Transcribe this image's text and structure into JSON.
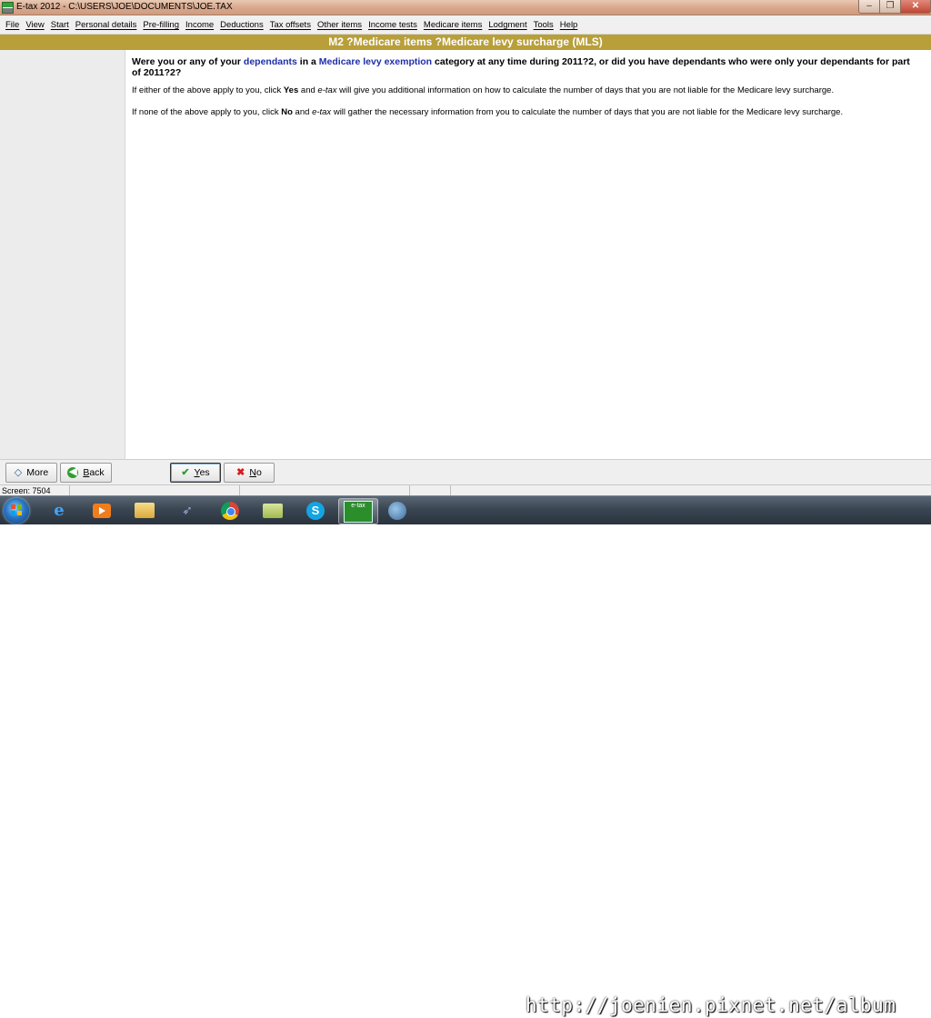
{
  "window": {
    "title": "E-tax 2012 - C:\\USERS\\JOE\\DOCUMENTS\\JOE.TAX",
    "minimize_symbol": "–",
    "maximize_symbol": "❐",
    "close_symbol": "✕"
  },
  "menu": {
    "items": [
      "File",
      "View",
      "Start",
      "Personal details",
      "Pre-filling",
      "Income",
      "Deductions",
      "Tax offsets",
      "Other items",
      "Income tests",
      "Medicare items",
      "Lodgment",
      "Tools",
      "Help"
    ]
  },
  "heading": "M2 ?Medicare items ?Medicare levy surcharge (MLS)",
  "content": {
    "question": {
      "part1": "Were you or any of your ",
      "link1": "dependants",
      "part2": " in a ",
      "link2": "Medicare levy exemption",
      "part3": " category at any time during 2011?2, or did you have dependants who were only your dependants for part of 2011?2?"
    },
    "para1": {
      "part1": "If either of the above apply to you, click ",
      "bold": "Yes",
      "part2": " and ",
      "italic": "e-tax",
      "part3": " will give you additional information on how to calculate the number of days that you are not liable for the Medicare levy surcharge."
    },
    "para2": {
      "part1": "If none of the above apply to you, click ",
      "bold": "No",
      "part2": " and ",
      "italic": "e-tax",
      "part3": " will gather the necessary information from you to calculate the number of days that you are not liable for the Medicare levy surcharge."
    }
  },
  "buttons": {
    "more": "More",
    "back_underlined": "B",
    "back_rest": "ack",
    "yes_underlined": "Y",
    "yes_rest": "es",
    "no_underlined": "N",
    "no_rest": "o"
  },
  "status": {
    "screen": "Screen: 7504"
  },
  "taskbar": {
    "etax_label": "e-tax",
    "skype_letter": "S",
    "ie_letter": "e"
  },
  "watermark": "http://joenien.pixnet.net/album",
  "colors": {
    "heading_bg": "#b89f3a",
    "link": "#1f2ea8",
    "yes_icon": "#2e9d2e",
    "no_icon": "#d21d1d"
  }
}
